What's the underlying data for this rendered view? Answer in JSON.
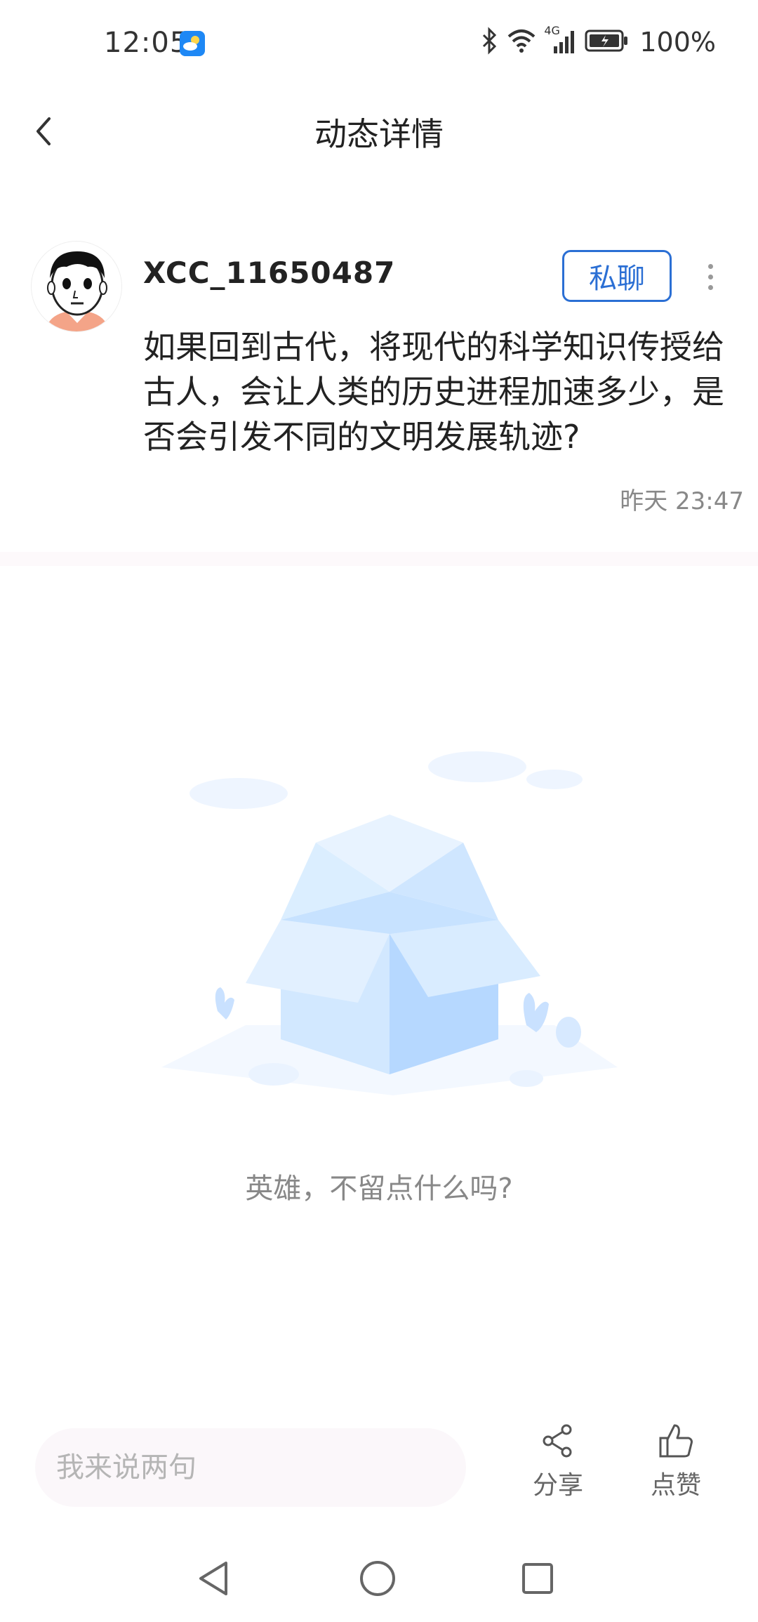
{
  "status_bar": {
    "time": "12:05",
    "network": "4G",
    "battery": "100%"
  },
  "header": {
    "title": "动态详情"
  },
  "post": {
    "username": "XCC_11650487",
    "chat_label": "私聊",
    "content": "如果回到古代，将现代的科学知识传授给古人，会让人类的历史进程加速多少，是否会引发不同的文明发展轨迹?",
    "time": "昨天 23:47"
  },
  "empty_state": {
    "message": "英雄，不留点什么吗?"
  },
  "bottom_bar": {
    "comment_placeholder": "我来说两句",
    "share_label": "分享",
    "like_label": "点赞"
  },
  "colors": {
    "accent": "#2b6fd4",
    "muted_text": "#888888",
    "illustration_blue": "#bcdcff"
  },
  "icons": {
    "back": "chevron-left-icon",
    "more": "more-vertical-icon",
    "share": "share-icon",
    "like": "thumbs-up-icon"
  }
}
